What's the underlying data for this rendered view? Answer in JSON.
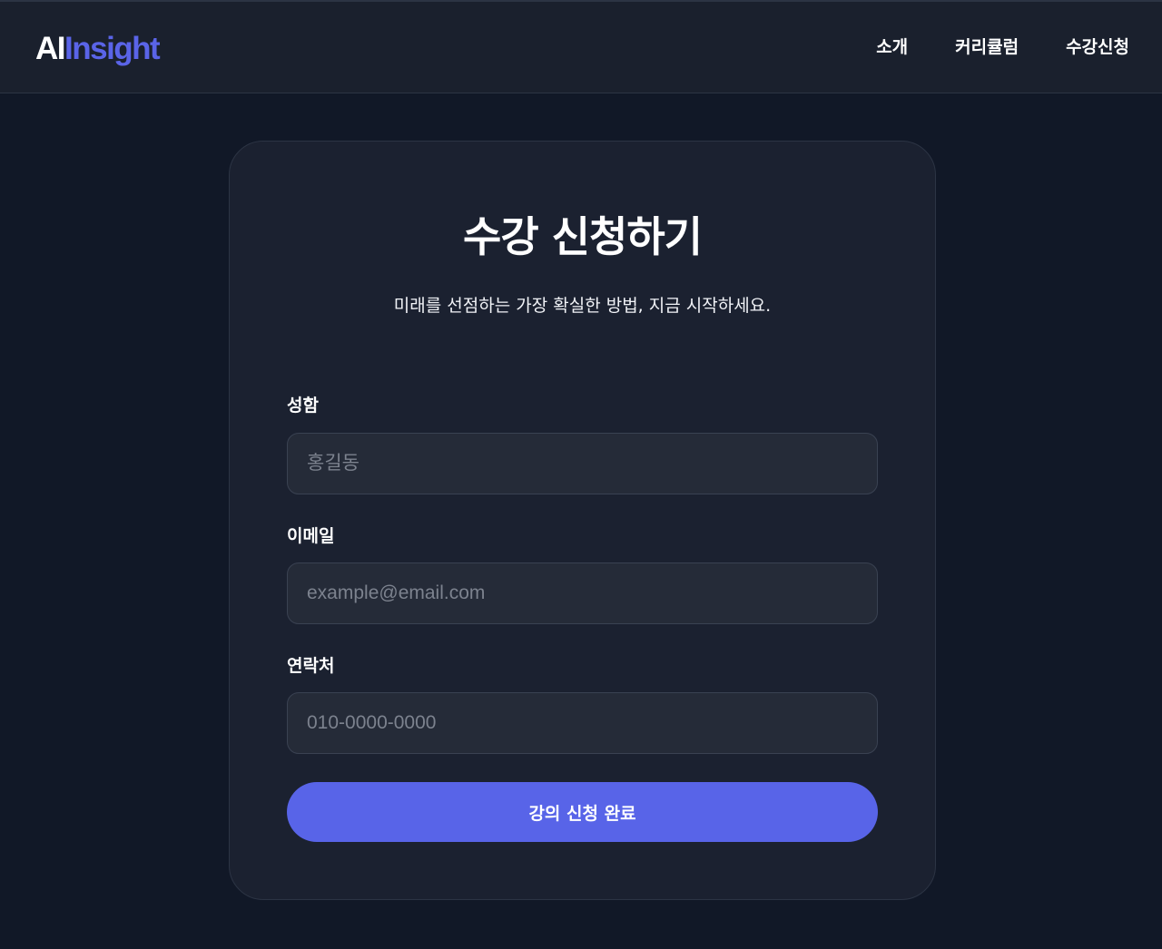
{
  "header": {
    "logo": {
      "part1": "AI",
      "part2": "Insight"
    },
    "nav": [
      "소개",
      "커리큘럼",
      "수강신청"
    ]
  },
  "card": {
    "title": "수강 신청하기",
    "subtitle": "미래를 선점하는 가장 확실한 방법, 지금 시작하세요.",
    "fields": [
      {
        "label": "성함",
        "placeholder": "홍길동",
        "value": ""
      },
      {
        "label": "이메일",
        "placeholder": "example@email.com",
        "value": ""
      },
      {
        "label": "연락처",
        "placeholder": "010-0000-0000",
        "value": ""
      }
    ],
    "submit_label": "강의 신청 완료"
  },
  "colors": {
    "background": "#111827",
    "header": "#1a202d",
    "card": "#1b2130",
    "input": "#252b38",
    "accent": "#5864e8"
  }
}
